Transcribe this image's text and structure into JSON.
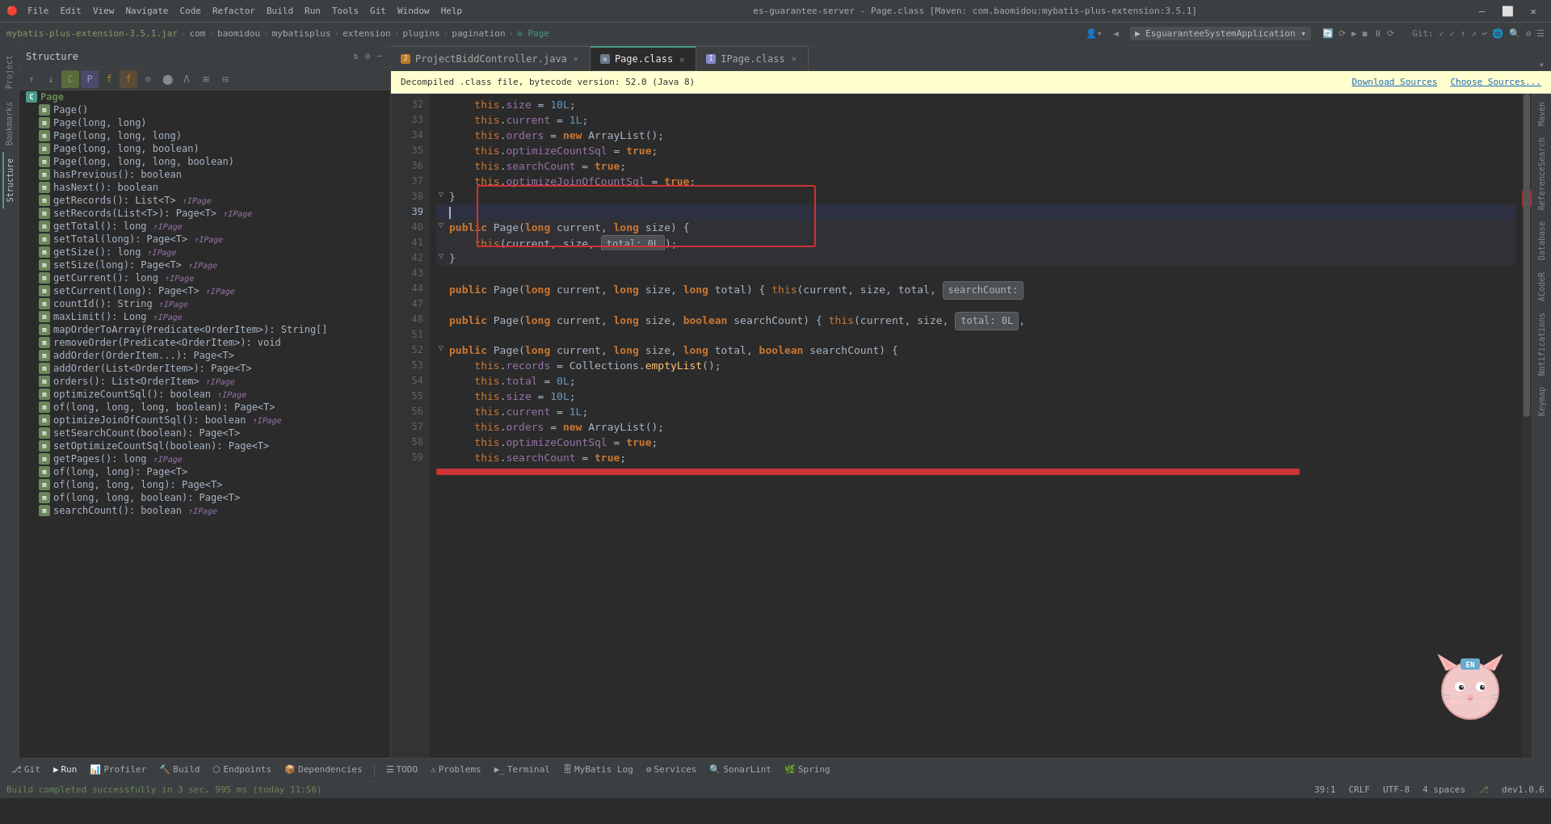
{
  "titlebar": {
    "icon": "🔴",
    "menu_items": [
      "File",
      "Edit",
      "View",
      "Navigate",
      "Code",
      "Refactor",
      "Build",
      "Run",
      "Tools",
      "Git",
      "Window",
      "Help"
    ],
    "title": "es-guarantee-server - Page.class [Maven: com.baomidou:mybatis-plus-extension:3.5.1]",
    "controls": [
      "—",
      "⬜",
      "✕"
    ]
  },
  "breadcrumb": {
    "segments": [
      "mybatis-plus-extension-3.5.1.jar",
      "com",
      "baomidou",
      "mybatisplus",
      "extension",
      "plugins",
      "pagination",
      "Page"
    ],
    "run_config": "EsguaranteeSystemApplication"
  },
  "structure": {
    "title": "Structure",
    "root": "Page",
    "items": [
      {
        "label": "Page()",
        "type": "m",
        "indent": 1
      },
      {
        "label": "Page(long, long)",
        "type": "m",
        "indent": 1
      },
      {
        "label": "Page(long, long, long)",
        "type": "m",
        "indent": 1
      },
      {
        "label": "Page(long, long, boolean)",
        "type": "m",
        "indent": 1
      },
      {
        "label": "Page(long, long, long, boolean)",
        "type": "m",
        "indent": 1
      },
      {
        "label": "hasPrevious(): boolean",
        "type": "m",
        "indent": 1
      },
      {
        "label": "hasNext(): boolean",
        "type": "m",
        "indent": 1
      },
      {
        "label": "getRecords(): List<T>",
        "type": "m",
        "indent": 1,
        "type_ref": "↑IPage"
      },
      {
        "label": "setRecords(List<T>): Page<T>",
        "type": "m",
        "indent": 1,
        "type_ref": "↑IPage"
      },
      {
        "label": "getTotal(): long",
        "type": "m",
        "indent": 1,
        "type_ref": "↑IPage"
      },
      {
        "label": "setTotal(long): Page<T>",
        "type": "m",
        "indent": 1,
        "type_ref": "↑IPage"
      },
      {
        "label": "getSize(): long",
        "type": "m",
        "indent": 1,
        "type_ref": "↑IPage"
      },
      {
        "label": "setSize(long): Page<T>",
        "type": "m",
        "indent": 1,
        "type_ref": "↑IPage"
      },
      {
        "label": "getCurrent(): long",
        "type": "m",
        "indent": 1,
        "type_ref": "↑IPage"
      },
      {
        "label": "setCurrent(long): Page<T>",
        "type": "m",
        "indent": 1,
        "type_ref": "↑IPage"
      },
      {
        "label": "countId(): String",
        "type": "m",
        "indent": 1,
        "type_ref": "↑IPage"
      },
      {
        "label": "maxLimit(): Long",
        "type": "m",
        "indent": 1,
        "type_ref": "↑IPage"
      },
      {
        "label": "mapOrderToArray(Predicate<OrderItem>): String[]",
        "type": "m",
        "indent": 1
      },
      {
        "label": "removeOrder(Predicate<OrderItem>): void",
        "type": "m",
        "indent": 1
      },
      {
        "label": "addOrder(OrderItem...): Page<T>",
        "type": "m",
        "indent": 1
      },
      {
        "label": "addOrder(List<OrderItem>): Page<T>",
        "type": "m",
        "indent": 1
      },
      {
        "label": "orders(): List<OrderItem>",
        "type": "m",
        "indent": 1,
        "type_ref": "↑IPage"
      },
      {
        "label": "optimizeCountSql(): boolean",
        "type": "m",
        "indent": 1,
        "type_ref": "↑IPage"
      },
      {
        "label": "of(long, long, long, boolean): Page<T>",
        "type": "m",
        "indent": 1
      },
      {
        "label": "optimizeJoinOfCountSql(): boolean",
        "type": "m",
        "indent": 1,
        "type_ref": "↑IPage"
      },
      {
        "label": "setSearchCount(boolean): Page<T>",
        "type": "m",
        "indent": 1
      },
      {
        "label": "setOptimizeCountSql(boolean): Page<T>",
        "type": "m",
        "indent": 1
      },
      {
        "label": "getPages(): long",
        "type": "m",
        "indent": 1,
        "type_ref": "↑IPage"
      },
      {
        "label": "of(long, long): Page<T>",
        "type": "m",
        "indent": 1
      },
      {
        "label": "of(long, long, long): Page<T>",
        "type": "m",
        "indent": 1
      },
      {
        "label": "of(long, long, boolean): Page<T>",
        "type": "m",
        "indent": 1
      },
      {
        "label": "searchCount(): boolean",
        "type": "m",
        "indent": 1,
        "type_ref": "↑IPage"
      }
    ]
  },
  "tabs": [
    {
      "label": "ProjectBiddController.java",
      "type": "java",
      "active": false,
      "closable": true
    },
    {
      "label": "Page.class",
      "type": "class",
      "active": true,
      "closable": true
    },
    {
      "label": "IPage.class",
      "type": "iface",
      "active": false,
      "closable": true
    }
  ],
  "info_bar": {
    "message": "Decompiled .class file, bytecode version: 52.0 (Java 8)",
    "download_label": "Download Sources",
    "choose_label": "Choose Sources..."
  },
  "code_lines": [
    {
      "num": 32,
      "content": "    this.size = 10L;",
      "type": "normal"
    },
    {
      "num": 33,
      "content": "    this.current = 1L;",
      "type": "normal"
    },
    {
      "num": 34,
      "content": "    this.orders = new ArrayList();",
      "type": "normal"
    },
    {
      "num": 35,
      "content": "    this.optimizeCountSql = true;",
      "type": "normal"
    },
    {
      "num": 36,
      "content": "    this.searchCount = true;",
      "type": "normal"
    },
    {
      "num": 37,
      "content": "    this.optimizeJoinOfCountSql = true;",
      "type": "normal"
    },
    {
      "num": 38,
      "content": "}",
      "type": "fold"
    },
    {
      "num": 39,
      "content": "",
      "type": "cursor"
    },
    {
      "num": 40,
      "content": "public Page(long current, long size) {",
      "type": "fold",
      "highlighted": true
    },
    {
      "num": 41,
      "content": "    this(current, size,    total: 0L);",
      "type": "normal",
      "highlighted": true
    },
    {
      "num": 42,
      "content": "}",
      "type": "fold",
      "highlighted": true
    },
    {
      "num": 43,
      "content": "",
      "type": "normal"
    },
    {
      "num": 44,
      "content": "public Page(long current, long size, long total) { this(current, size, total,    searchCount:",
      "type": "normal"
    },
    {
      "num": 47,
      "content": "",
      "type": "normal"
    },
    {
      "num": 48,
      "content": "public Page(long current, long size, boolean searchCount) { this(current, size,    total: 0L,",
      "type": "normal"
    },
    {
      "num": 51,
      "content": "",
      "type": "normal"
    },
    {
      "num": 52,
      "content": "public Page(long current, long size, long total, boolean searchCount) {",
      "type": "fold"
    },
    {
      "num": 53,
      "content": "    this.records = Collections.emptyList();",
      "type": "normal"
    },
    {
      "num": 54,
      "content": "    this.total = 0L;",
      "type": "normal"
    },
    {
      "num": 55,
      "content": "    this.size = 10L;",
      "type": "normal"
    },
    {
      "num": 56,
      "content": "    this.current = 1L;",
      "type": "normal"
    },
    {
      "num": 57,
      "content": "    this.orders = new ArrayList();",
      "type": "normal"
    },
    {
      "num": 58,
      "content": "    this.optimizeCountSql = true;",
      "type": "normal"
    },
    {
      "num": 59,
      "content": "    this.searchCount = true;",
      "type": "normal"
    }
  ],
  "bottom_tabs": [
    {
      "label": "Git",
      "icon": "git"
    },
    {
      "label": "Run",
      "icon": "run"
    },
    {
      "label": "Profiler",
      "icon": "profiler"
    },
    {
      "label": "Build",
      "icon": "build"
    },
    {
      "label": "Endpoints",
      "icon": "endpoints"
    },
    {
      "label": "Dependencies",
      "icon": "dependencies"
    },
    {
      "label": "TODO",
      "icon": "todo"
    },
    {
      "label": "Problems",
      "icon": "problems"
    },
    {
      "label": "Terminal",
      "icon": "terminal"
    },
    {
      "label": "MyBatis Log",
      "icon": "mybatis"
    },
    {
      "label": "Services",
      "icon": "services"
    },
    {
      "label": "SonarLint",
      "icon": "sonarlint"
    },
    {
      "label": "Spring",
      "icon": "spring"
    }
  ],
  "status_bar": {
    "message": "Build completed successfully in 3 sec, 995 ms (today 11:56)",
    "position": "39:1",
    "line_ending": "CRLF",
    "encoding": "UTF-8",
    "indent": "4 spaces",
    "branch": "dev1.0.6"
  },
  "right_panels": [
    "Maven",
    "ReferenceSearch",
    "Database",
    "ACodeR",
    "Notifications",
    "Keymap"
  ],
  "left_panels": [
    "Project",
    "Bookmarks",
    "Structure"
  ],
  "colors": {
    "accent": "#4a9d8a",
    "keyword": "#cc7832",
    "string": "#6a8759",
    "number": "#6897bb",
    "comment": "#808080",
    "field": "#9876aa"
  }
}
